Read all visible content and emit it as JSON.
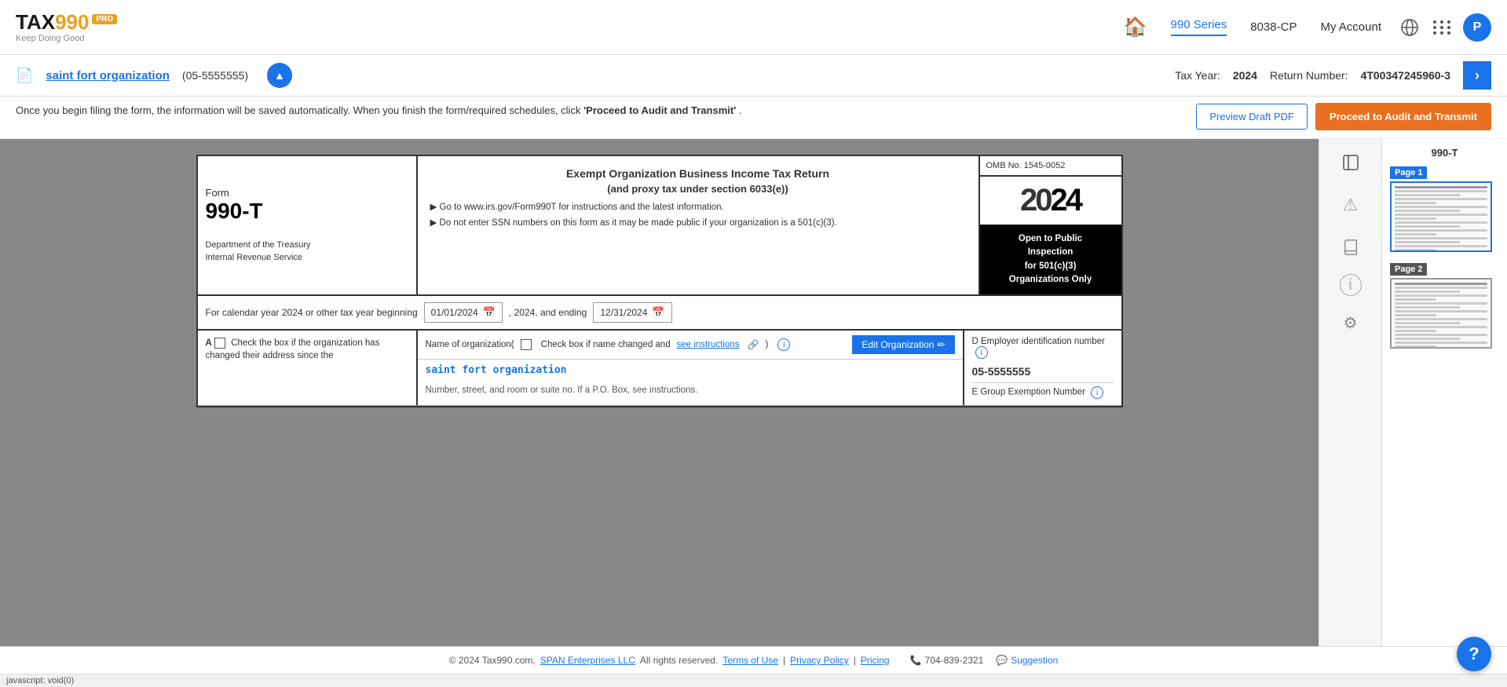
{
  "header": {
    "logo": {
      "tax": "TAX",
      "nine90": "990",
      "pro_badge": "PRO",
      "tagline": "Keep Doing Good"
    },
    "nav": {
      "home_icon": "🏠",
      "series_label": "990 Series",
      "form_label": "8038-CP",
      "account_label": "My Account"
    },
    "avatar_letter": "P"
  },
  "sub_header": {
    "org_icon": "📄",
    "org_name": "saint fort organization",
    "org_ein": "(05-5555555)",
    "chevron": "▲",
    "tax_year_label": "Tax Year:",
    "tax_year_value": "2024",
    "return_label": "Return Number:",
    "return_value": "4T00347245960-3",
    "next_btn": "›"
  },
  "instructions_bar": {
    "text_part1": "Once you begin filing the form, the information will be saved automatically. When you finish the form/required schedules, click ",
    "bold_text": "'Proceed to Audit and Transmit'",
    "text_part2": ".",
    "preview_btn": "Preview Draft PDF",
    "proceed_btn": "Proceed to Audit and Transmit"
  },
  "form": {
    "omb": "OMB No. 1545-0052",
    "year_display": "2024",
    "form_number_prefix": "Form",
    "form_number": "990-T",
    "title_line1": "Exempt Organization Business Income Tax Return",
    "title_line2": "(and proxy tax under section 6033(e))",
    "instruction1": "▶ Go to www.irs.gov/Form990T for instructions and the latest information.",
    "instruction2": "▶ Do not enter SSN numbers on this form as it may be made public if your organization is a 501(c)(3).",
    "dept_line1": "Department of the Treasury",
    "dept_line2": "Internal Revenue Service",
    "public_inspection": "Open to Public\nInspection\nfor 501(c)(3)\nOrganizations Only",
    "calendar_year_label": "For calendar year 2024 or other tax year beginning",
    "start_date": "01/01/2024",
    "date_sep": ", 2024, and ending",
    "end_date": "12/31/2024",
    "field_a_label": "A",
    "field_a_text": "Check the box if the organization has changed their address since the",
    "field_b_label": "Name of organization(",
    "field_b_check_text": "Check box if name changed and",
    "see_instructions": "see instructions",
    "org_name_display": "saint fort organization",
    "edit_org_btn": "Edit Organization",
    "address_label": "Number, street, and room or suite no. If a P.O. Box, see instructions.",
    "field_d_label": "D Employer identification number",
    "ein_value": "05-5555555",
    "field_e_label": "E Group Exemption Number"
  },
  "sidebar_icons": {
    "nav_icon": "›",
    "warning_icon": "⚠",
    "book_icon": "📖",
    "info_icon": "ℹ",
    "settings_icon": "⚙"
  },
  "pages_panel": {
    "form_label": "990-T",
    "page1_label": "Page 1",
    "page2_label": "Page 2"
  },
  "footer": {
    "copyright": "© 2024 Tax990.com,",
    "span_link": "SPAN Enterprises LLC",
    "all_rights": "All rights reserved.",
    "terms_link": "Terms of Use",
    "privacy_link": "Privacy Policy",
    "pricing_link": "Pricing",
    "phone": "704-839-2321",
    "suggestion": "Suggestion"
  },
  "status_bar": {
    "text": "javascript: void(0)"
  },
  "help_btn": "?"
}
